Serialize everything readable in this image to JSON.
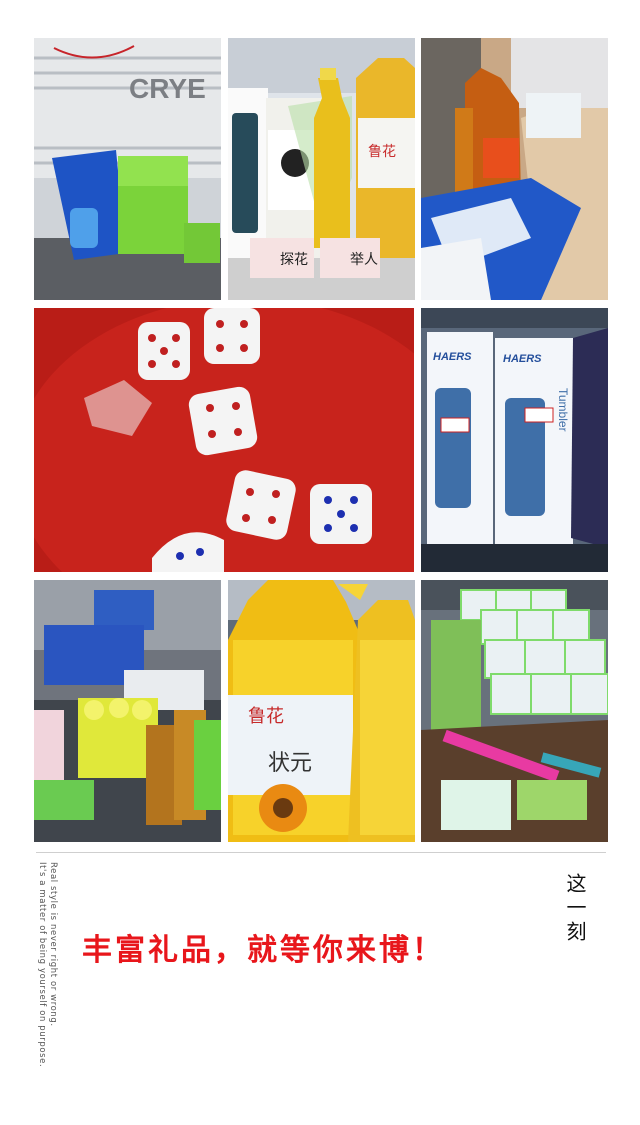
{
  "photos": [
    {
      "name": "soap-tissues"
    },
    {
      "name": "toothpaste-oil-awards"
    },
    {
      "name": "oil-bottles-table"
    },
    {
      "name": "dice-red-plate"
    },
    {
      "name": "tumbler-boxes"
    },
    {
      "name": "prize-table"
    },
    {
      "name": "sunflower-oil"
    },
    {
      "name": "tissue-stack-toothbrushes"
    }
  ],
  "labels": {
    "tag_tanhua": "探花",
    "tag_juren": "举人",
    "tag_zhuangyuan": "状元",
    "brand_luhua": "鲁花",
    "brand_haers": "HAERS",
    "tumbler": "Tumbler",
    "signage": "CRYE"
  },
  "side_text": {
    "line1": "Real style is never right or wrong.",
    "line2": "It's a matter of being yourself on purpose."
  },
  "moment": "这一刻",
  "headline": "丰富礼品，就等你来博！",
  "colors": {
    "headline": "#e8161b",
    "dice_plate": "#c8231c"
  }
}
